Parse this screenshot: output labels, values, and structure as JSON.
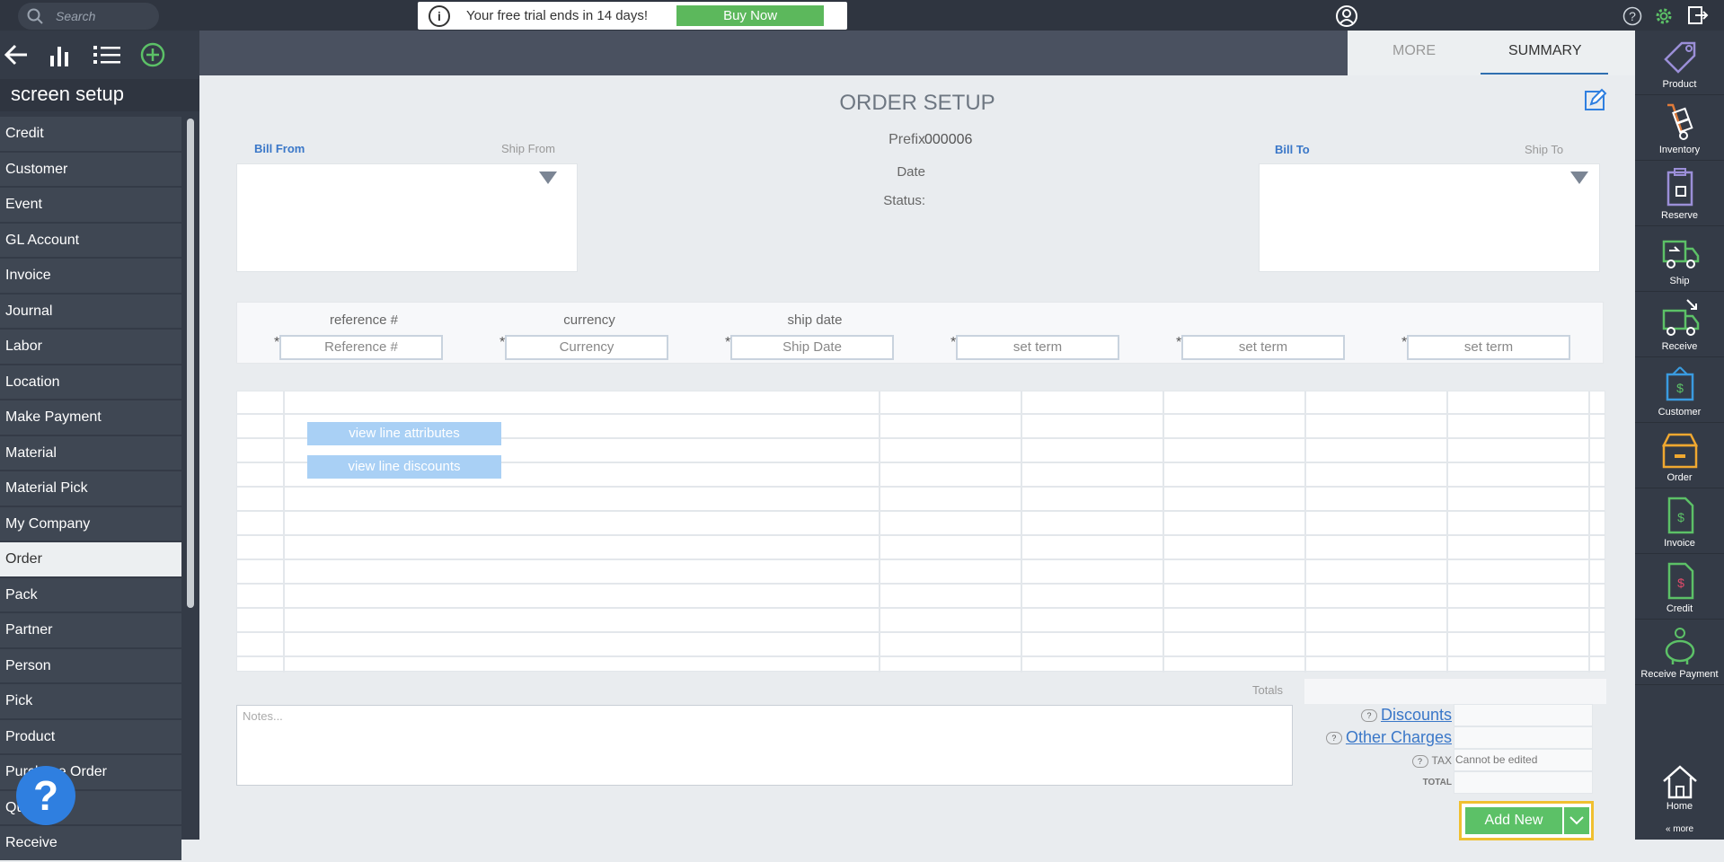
{
  "topbar": {
    "search_placeholder": "Search",
    "trial_text": "Your free trial ends in 14 days!",
    "buy_label": "Buy Now"
  },
  "leftnav": {
    "title": "screen setup",
    "items": [
      "Credit",
      "Customer",
      "Event",
      "GL Account",
      "Invoice",
      "Journal",
      "Labor",
      "Location",
      "Make Payment",
      "Material",
      "Material Pick",
      "My Company",
      "Order",
      "Pack",
      "Partner",
      "Person",
      "Pick",
      "Product",
      "Purchase Order",
      "Quote",
      "Receive"
    ],
    "active": "Order"
  },
  "tabs": {
    "more": "MORE",
    "summary": "SUMMARY"
  },
  "order": {
    "title": "ORDER SETUP",
    "bill_from": "Bill From",
    "ship_from": "Ship From",
    "bill_to": "Bill To",
    "ship_to": "Ship To",
    "prefix_label": "Prefix",
    "prefix_value": "000006",
    "date_label": "Date",
    "status_label": "Status:"
  },
  "fields": [
    {
      "label": "reference #",
      "placeholder": "Reference #"
    },
    {
      "label": "currency",
      "placeholder": "Currency"
    },
    {
      "label": "ship date",
      "placeholder": "Ship Date"
    },
    {
      "label": "",
      "placeholder": "set term"
    },
    {
      "label": "",
      "placeholder": "set term"
    },
    {
      "label": "",
      "placeholder": "set term"
    }
  ],
  "grid": {
    "btn_attributes": "view line attributes",
    "btn_discounts": "view line discounts"
  },
  "totals": {
    "label": "Totals",
    "discounts": "Discounts",
    "other_charges": "Other Charges",
    "tax": "TAX",
    "tax_value": "Cannot be edited",
    "total": "TOTAL"
  },
  "notes_placeholder": "Notes...",
  "add_new": "Add New",
  "rightnav": {
    "items": [
      "Product",
      "Inventory",
      "Reserve",
      "Ship",
      "Receive",
      "Customer",
      "Order",
      "Invoice",
      "Credit",
      "Receive Payment"
    ],
    "home": "Home",
    "more": "« more"
  },
  "colors": {
    "accent": "#5cb85c",
    "sidebar": "#343b47",
    "link": "#3a77c8",
    "highlight": "#f0c030"
  }
}
